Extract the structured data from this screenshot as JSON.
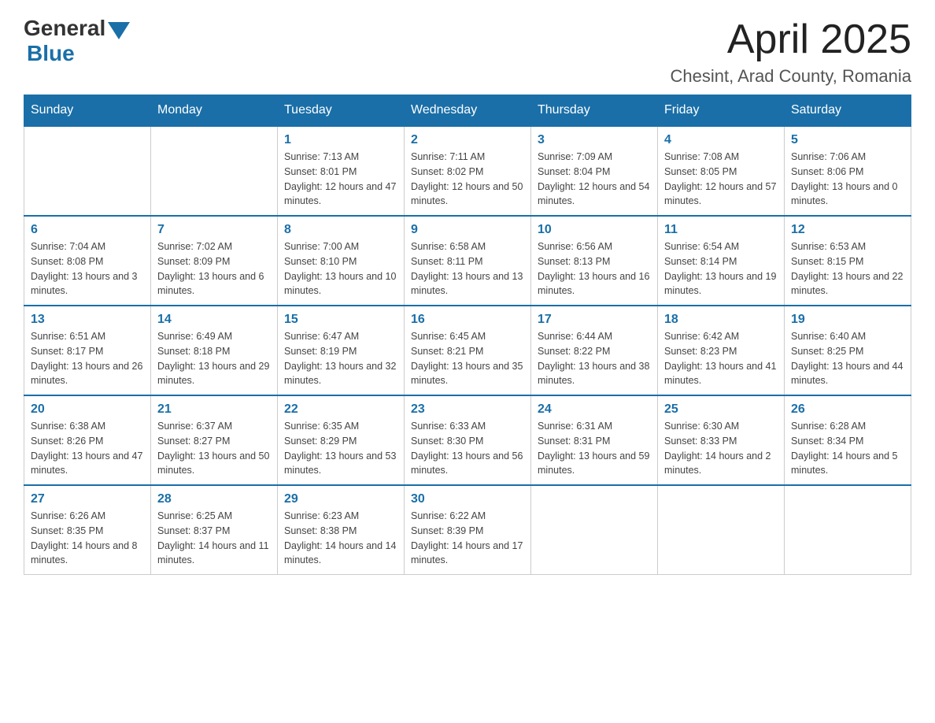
{
  "header": {
    "logo_general": "General",
    "logo_blue": "Blue",
    "month_year": "April 2025",
    "location": "Chesint, Arad County, Romania"
  },
  "days_of_week": [
    "Sunday",
    "Monday",
    "Tuesday",
    "Wednesday",
    "Thursday",
    "Friday",
    "Saturday"
  ],
  "weeks": [
    [
      {
        "day": "",
        "sunrise": "",
        "sunset": "",
        "daylight": ""
      },
      {
        "day": "",
        "sunrise": "",
        "sunset": "",
        "daylight": ""
      },
      {
        "day": "1",
        "sunrise": "Sunrise: 7:13 AM",
        "sunset": "Sunset: 8:01 PM",
        "daylight": "Daylight: 12 hours and 47 minutes."
      },
      {
        "day": "2",
        "sunrise": "Sunrise: 7:11 AM",
        "sunset": "Sunset: 8:02 PM",
        "daylight": "Daylight: 12 hours and 50 minutes."
      },
      {
        "day": "3",
        "sunrise": "Sunrise: 7:09 AM",
        "sunset": "Sunset: 8:04 PM",
        "daylight": "Daylight: 12 hours and 54 minutes."
      },
      {
        "day": "4",
        "sunrise": "Sunrise: 7:08 AM",
        "sunset": "Sunset: 8:05 PM",
        "daylight": "Daylight: 12 hours and 57 minutes."
      },
      {
        "day": "5",
        "sunrise": "Sunrise: 7:06 AM",
        "sunset": "Sunset: 8:06 PM",
        "daylight": "Daylight: 13 hours and 0 minutes."
      }
    ],
    [
      {
        "day": "6",
        "sunrise": "Sunrise: 7:04 AM",
        "sunset": "Sunset: 8:08 PM",
        "daylight": "Daylight: 13 hours and 3 minutes."
      },
      {
        "day": "7",
        "sunrise": "Sunrise: 7:02 AM",
        "sunset": "Sunset: 8:09 PM",
        "daylight": "Daylight: 13 hours and 6 minutes."
      },
      {
        "day": "8",
        "sunrise": "Sunrise: 7:00 AM",
        "sunset": "Sunset: 8:10 PM",
        "daylight": "Daylight: 13 hours and 10 minutes."
      },
      {
        "day": "9",
        "sunrise": "Sunrise: 6:58 AM",
        "sunset": "Sunset: 8:11 PM",
        "daylight": "Daylight: 13 hours and 13 minutes."
      },
      {
        "day": "10",
        "sunrise": "Sunrise: 6:56 AM",
        "sunset": "Sunset: 8:13 PM",
        "daylight": "Daylight: 13 hours and 16 minutes."
      },
      {
        "day": "11",
        "sunrise": "Sunrise: 6:54 AM",
        "sunset": "Sunset: 8:14 PM",
        "daylight": "Daylight: 13 hours and 19 minutes."
      },
      {
        "day": "12",
        "sunrise": "Sunrise: 6:53 AM",
        "sunset": "Sunset: 8:15 PM",
        "daylight": "Daylight: 13 hours and 22 minutes."
      }
    ],
    [
      {
        "day": "13",
        "sunrise": "Sunrise: 6:51 AM",
        "sunset": "Sunset: 8:17 PM",
        "daylight": "Daylight: 13 hours and 26 minutes."
      },
      {
        "day": "14",
        "sunrise": "Sunrise: 6:49 AM",
        "sunset": "Sunset: 8:18 PM",
        "daylight": "Daylight: 13 hours and 29 minutes."
      },
      {
        "day": "15",
        "sunrise": "Sunrise: 6:47 AM",
        "sunset": "Sunset: 8:19 PM",
        "daylight": "Daylight: 13 hours and 32 minutes."
      },
      {
        "day": "16",
        "sunrise": "Sunrise: 6:45 AM",
        "sunset": "Sunset: 8:21 PM",
        "daylight": "Daylight: 13 hours and 35 minutes."
      },
      {
        "day": "17",
        "sunrise": "Sunrise: 6:44 AM",
        "sunset": "Sunset: 8:22 PM",
        "daylight": "Daylight: 13 hours and 38 minutes."
      },
      {
        "day": "18",
        "sunrise": "Sunrise: 6:42 AM",
        "sunset": "Sunset: 8:23 PM",
        "daylight": "Daylight: 13 hours and 41 minutes."
      },
      {
        "day": "19",
        "sunrise": "Sunrise: 6:40 AM",
        "sunset": "Sunset: 8:25 PM",
        "daylight": "Daylight: 13 hours and 44 minutes."
      }
    ],
    [
      {
        "day": "20",
        "sunrise": "Sunrise: 6:38 AM",
        "sunset": "Sunset: 8:26 PM",
        "daylight": "Daylight: 13 hours and 47 minutes."
      },
      {
        "day": "21",
        "sunrise": "Sunrise: 6:37 AM",
        "sunset": "Sunset: 8:27 PM",
        "daylight": "Daylight: 13 hours and 50 minutes."
      },
      {
        "day": "22",
        "sunrise": "Sunrise: 6:35 AM",
        "sunset": "Sunset: 8:29 PM",
        "daylight": "Daylight: 13 hours and 53 minutes."
      },
      {
        "day": "23",
        "sunrise": "Sunrise: 6:33 AM",
        "sunset": "Sunset: 8:30 PM",
        "daylight": "Daylight: 13 hours and 56 minutes."
      },
      {
        "day": "24",
        "sunrise": "Sunrise: 6:31 AM",
        "sunset": "Sunset: 8:31 PM",
        "daylight": "Daylight: 13 hours and 59 minutes."
      },
      {
        "day": "25",
        "sunrise": "Sunrise: 6:30 AM",
        "sunset": "Sunset: 8:33 PM",
        "daylight": "Daylight: 14 hours and 2 minutes."
      },
      {
        "day": "26",
        "sunrise": "Sunrise: 6:28 AM",
        "sunset": "Sunset: 8:34 PM",
        "daylight": "Daylight: 14 hours and 5 minutes."
      }
    ],
    [
      {
        "day": "27",
        "sunrise": "Sunrise: 6:26 AM",
        "sunset": "Sunset: 8:35 PM",
        "daylight": "Daylight: 14 hours and 8 minutes."
      },
      {
        "day": "28",
        "sunrise": "Sunrise: 6:25 AM",
        "sunset": "Sunset: 8:37 PM",
        "daylight": "Daylight: 14 hours and 11 minutes."
      },
      {
        "day": "29",
        "sunrise": "Sunrise: 6:23 AM",
        "sunset": "Sunset: 8:38 PM",
        "daylight": "Daylight: 14 hours and 14 minutes."
      },
      {
        "day": "30",
        "sunrise": "Sunrise: 6:22 AM",
        "sunset": "Sunset: 8:39 PM",
        "daylight": "Daylight: 14 hours and 17 minutes."
      },
      {
        "day": "",
        "sunrise": "",
        "sunset": "",
        "daylight": ""
      },
      {
        "day": "",
        "sunrise": "",
        "sunset": "",
        "daylight": ""
      },
      {
        "day": "",
        "sunrise": "",
        "sunset": "",
        "daylight": ""
      }
    ]
  ]
}
